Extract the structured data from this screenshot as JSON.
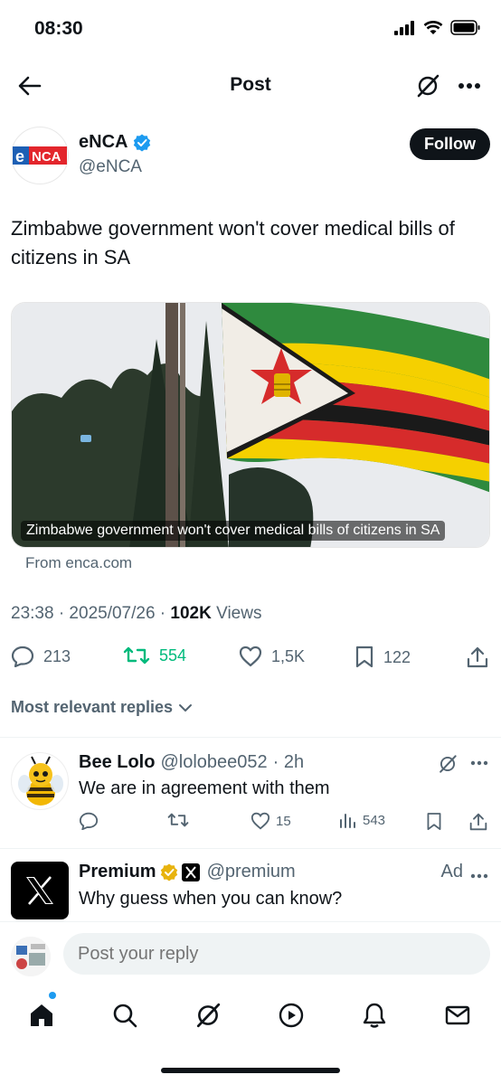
{
  "status_bar": {
    "time": "08:30"
  },
  "header": {
    "title": "Post"
  },
  "author": {
    "name": "eNCA",
    "handle": "@eNCA",
    "logo_text": "eNCA",
    "follow_label": "Follow"
  },
  "post": {
    "text": "Zimbabwe government won't cover medical bills of citizens in SA",
    "card_caption": "Zimbabwe government won't cover medical bills of citizens in SA",
    "card_source": "From enca.com",
    "time_date": "23:38 · 2025/07/26 · ",
    "views_count": "102K",
    "views_label": " Views"
  },
  "actions": {
    "replies": "213",
    "reposts": "554",
    "likes": "1,5K",
    "bookmarks": "122"
  },
  "replies_filter": {
    "label": "Most relevant replies"
  },
  "reply": {
    "name": "Bee Lolo",
    "handle": "@lolobee052",
    "time": "· 2h",
    "text": "We are in agreement with them",
    "likes": "15",
    "views": "543"
  },
  "ad": {
    "name": "Premium",
    "handle": "@premium",
    "tag": "Ad",
    "text": "Why guess when you can know?"
  },
  "reply_bar": {
    "placeholder": "Post your reply"
  },
  "colors": {
    "accent": "#1d9bf0",
    "repost_active": "#00ba7c",
    "text": "#0f1419",
    "secondary": "#536471"
  },
  "icons": [
    "back-arrow-icon",
    "grok-icon",
    "more-icon",
    "verified-icon",
    "reply-icon",
    "repost-icon",
    "like-icon",
    "bookmark-icon",
    "share-icon",
    "chevron-down-icon",
    "views-icon",
    "home-icon",
    "search-icon",
    "play-icon",
    "bell-icon",
    "mail-icon"
  ]
}
